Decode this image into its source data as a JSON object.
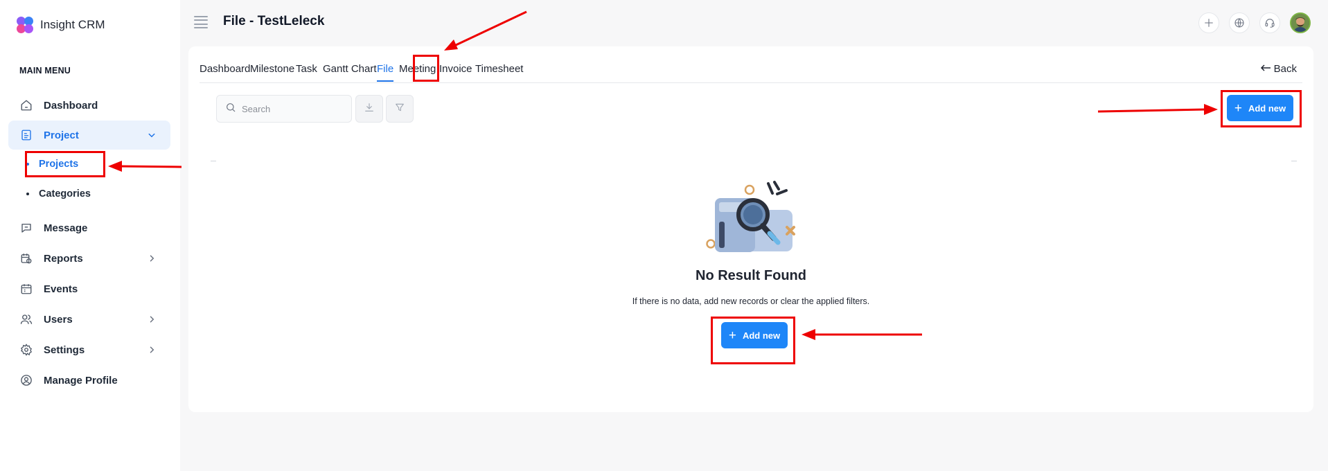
{
  "app": {
    "name": "Insight CRM"
  },
  "sidebar": {
    "section_title": "MAIN MENU",
    "items": [
      {
        "label": "Dashboard",
        "icon": "home-icon"
      },
      {
        "label": "Project",
        "icon": "document-icon",
        "active": true,
        "expanded": true
      },
      {
        "label": "Message",
        "icon": "chat-icon"
      },
      {
        "label": "Reports",
        "icon": "calendar-report-icon",
        "has_children": true
      },
      {
        "label": "Events",
        "icon": "calendar-icon"
      },
      {
        "label": "Users",
        "icon": "users-icon",
        "has_children": true
      },
      {
        "label": "Settings",
        "icon": "gear-icon",
        "has_children": true
      },
      {
        "label": "Manage Profile",
        "icon": "user-circle-icon"
      }
    ],
    "project_children": [
      {
        "label": "Projects",
        "active": true
      },
      {
        "label": "Categories"
      }
    ]
  },
  "header": {
    "title": "File - TestLeleck",
    "actions": [
      "plus-icon",
      "globe-icon",
      "headset-icon",
      "avatar"
    ]
  },
  "tabs": {
    "items": [
      "Dashboard",
      "Milestone",
      "Task",
      "Gantt Chart",
      "File",
      "Meeting",
      "Invoice",
      "Timesheet"
    ],
    "active": "File",
    "back_label": "Back"
  },
  "toolbar": {
    "search_placeholder": "Search",
    "add_new_label": "Add new"
  },
  "empty_state": {
    "title": "No Result Found",
    "message": "If there is no data, add new records or clear the applied filters.",
    "button_label": "Add new"
  },
  "colors": {
    "primary": "#1e86f8",
    "active_text": "#1e73e8",
    "active_bg": "#eaf2fd",
    "annotation": "#ee0000"
  }
}
